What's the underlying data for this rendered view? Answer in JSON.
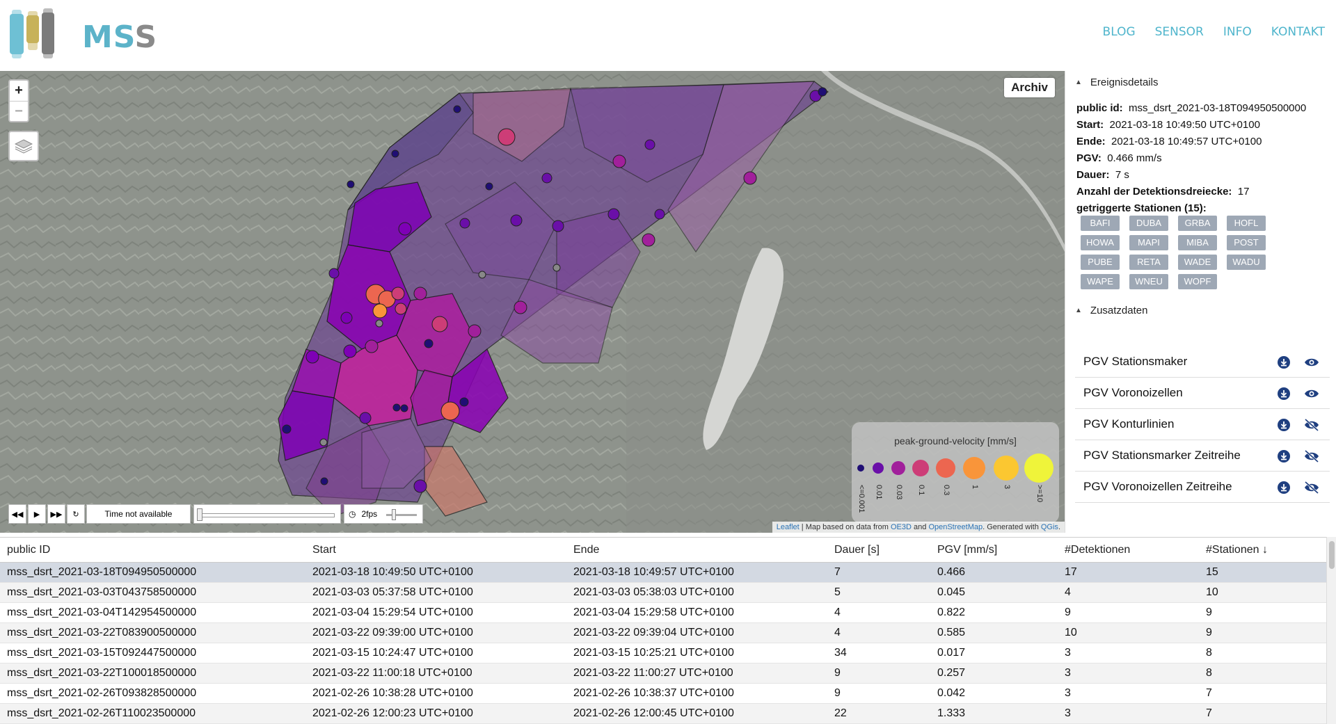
{
  "header": {
    "logo_text_a": "MS",
    "logo_text_b": "S",
    "nav": [
      "BLOG",
      "SENSOR",
      "INFO",
      "KONTAKT"
    ]
  },
  "map": {
    "archiv_label": "Archiv",
    "legend": {
      "title": "peak-ground-velocity [mm/s]",
      "labels": [
        "<=0.001",
        "0.01",
        "0.03",
        "0.1",
        "0.3",
        "1",
        "3",
        ">=10"
      ],
      "colors": [
        "#1f0e74",
        "#6a0fa8",
        "#a1209b",
        "#cd3d77",
        "#ec6650",
        "#f9953a",
        "#fbc731",
        "#eff43a"
      ]
    },
    "time": {
      "label": "Time not available",
      "fps": "2fps"
    },
    "attribution": {
      "leaflet": "Leaflet",
      "pre": " | Map based on data from ",
      "oe3d": "OE3D",
      "mid": " and ",
      "osm": "OpenStreetMap",
      "post": ". Generated with ",
      "qgis": "QGis",
      "end": "."
    }
  },
  "details": {
    "section_title": "Ereignisdetails",
    "fields": [
      {
        "label": "public id:",
        "value": "mss_dsrt_2021-03-18T094950500000"
      },
      {
        "label": "Start:",
        "value": "2021-03-18 10:49:50 UTC+0100"
      },
      {
        "label": "Ende:",
        "value": "2021-03-18 10:49:57 UTC+0100"
      },
      {
        "label": "PGV:",
        "value": "0.466 mm/s"
      },
      {
        "label": "Dauer:",
        "value": "7 s"
      },
      {
        "label": "Anzahl der Detektionsdreiecke:",
        "value": "17"
      }
    ],
    "stations_label": "getriggerte Stationen (15):",
    "stations": [
      "BAFI",
      "DUBA",
      "GRBA",
      "HOFL",
      "HOWA",
      "MAPI",
      "MIBA",
      "POST",
      "PUBE",
      "RETA",
      "WADE",
      "WADU",
      "WAPE",
      "WNEU",
      "WOPF"
    ]
  },
  "extra": {
    "section_title": "Zusatzdaten",
    "layers": [
      {
        "name": "PGV Stationsmaker",
        "visible": true
      },
      {
        "name": "PGV Voronoizellen",
        "visible": true
      },
      {
        "name": "PGV Konturlinien",
        "visible": false
      },
      {
        "name": "PGV Stationsmarker Zeitreihe",
        "visible": false
      },
      {
        "name": "PGV Voronoizellen Zeitreihe",
        "visible": false
      }
    ]
  },
  "table": {
    "headers": [
      "public ID",
      "Start",
      "Ende",
      "Dauer [s]",
      "PGV [mm/s]",
      "#Detektionen",
      "#Stationen"
    ],
    "sort_indicator": "↓",
    "rows": [
      [
        "mss_dsrt_2021-03-18T094950500000",
        "2021-03-18 10:49:50 UTC+0100",
        "2021-03-18 10:49:57 UTC+0100",
        "7",
        "0.466",
        "17",
        "15"
      ],
      [
        "mss_dsrt_2021-03-03T043758500000",
        "2021-03-03 05:37:58 UTC+0100",
        "2021-03-03 05:38:03 UTC+0100",
        "5",
        "0.045",
        "4",
        "10"
      ],
      [
        "mss_dsrt_2021-03-04T142954500000",
        "2021-03-04 15:29:54 UTC+0100",
        "2021-03-04 15:29:58 UTC+0100",
        "4",
        "0.822",
        "9",
        "9"
      ],
      [
        "mss_dsrt_2021-03-22T083900500000",
        "2021-03-22 09:39:00 UTC+0100",
        "2021-03-22 09:39:04 UTC+0100",
        "4",
        "0.585",
        "10",
        "9"
      ],
      [
        "mss_dsrt_2021-03-15T092447500000",
        "2021-03-15 10:24:47 UTC+0100",
        "2021-03-15 10:25:21 UTC+0100",
        "34",
        "0.017",
        "3",
        "8"
      ],
      [
        "mss_dsrt_2021-03-22T100018500000",
        "2021-03-22 11:00:18 UTC+0100",
        "2021-03-22 11:00:27 UTC+0100",
        "9",
        "0.257",
        "3",
        "8"
      ],
      [
        "mss_dsrt_2021-02-26T093828500000",
        "2021-02-26 10:38:28 UTC+0100",
        "2021-02-26 10:38:37 UTC+0100",
        "9",
        "0.042",
        "3",
        "7"
      ],
      [
        "mss_dsrt_2021-02-26T110023500000",
        "2021-02-26 12:00:23 UTC+0100",
        "2021-02-26 12:00:45 UTC+0100",
        "22",
        "1.333",
        "3",
        "7"
      ]
    ]
  }
}
